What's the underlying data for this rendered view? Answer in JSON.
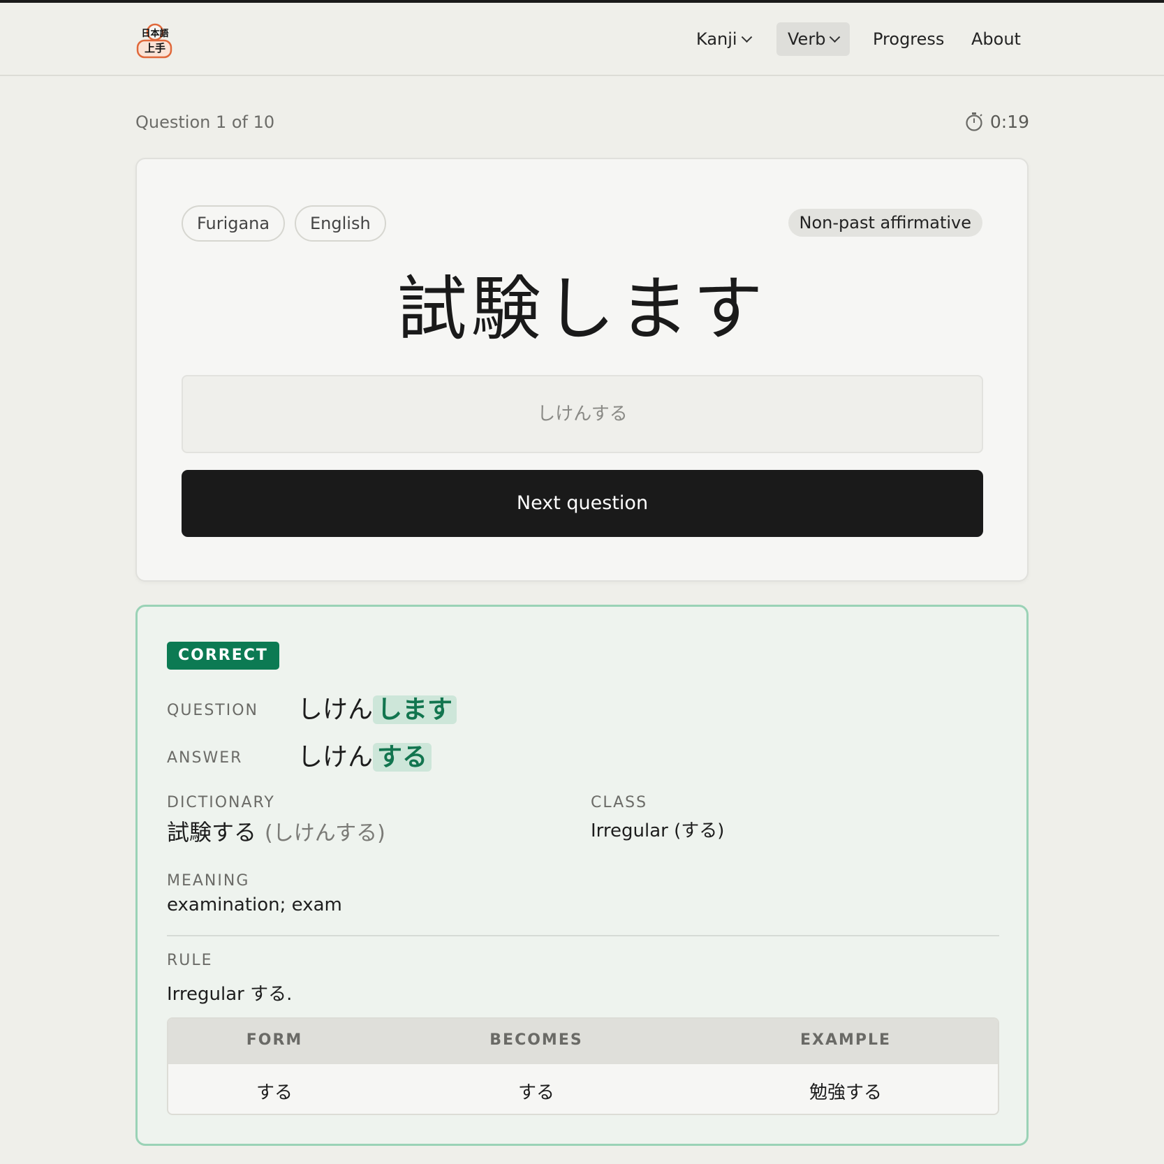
{
  "header": {
    "logo_text_line1": "日本語",
    "logo_text_line2": "上手",
    "nav": [
      {
        "label": "Kanji",
        "dropdown": true,
        "active": false
      },
      {
        "label": "Verb",
        "dropdown": true,
        "active": true
      },
      {
        "label": "Progress",
        "dropdown": false,
        "active": false
      },
      {
        "label": "About",
        "dropdown": false,
        "active": false
      }
    ]
  },
  "quiz": {
    "progress_label": "Question 1 of 10",
    "timer": "0:19",
    "timer_icon": "stopwatch-icon",
    "toggles": [
      "Furigana",
      "English"
    ],
    "form_tag": "Non-past affirmative",
    "prompt": "試験します",
    "answer_value": "しけんする",
    "next_label": "Next question"
  },
  "result": {
    "status": "CORRECT",
    "question_label": "QUESTION",
    "question_stem": "しけん",
    "question_ending": "します",
    "answer_label": "ANSWER",
    "answer_stem": "しけん",
    "answer_ending": "する",
    "dictionary_label": "DICTIONARY",
    "dictionary_word": "試験する",
    "dictionary_reading": "(しけんする)",
    "class_label": "CLASS",
    "class_value": "Irregular (する)",
    "meaning_label": "MEANING",
    "meaning_value": "examination; exam",
    "rule_label": "RULE",
    "rule_value": "Irregular する.",
    "table": {
      "headers": [
        "FORM",
        "BECOMES",
        "EXAMPLE"
      ],
      "rows": [
        [
          "する",
          "する",
          "勉強する"
        ]
      ]
    }
  },
  "colors": {
    "accent_green": "#0c7a53",
    "highlight_green": "#cde6d9",
    "button_dark": "#1a1a1a",
    "card_border_green": "#9ad2b6"
  }
}
